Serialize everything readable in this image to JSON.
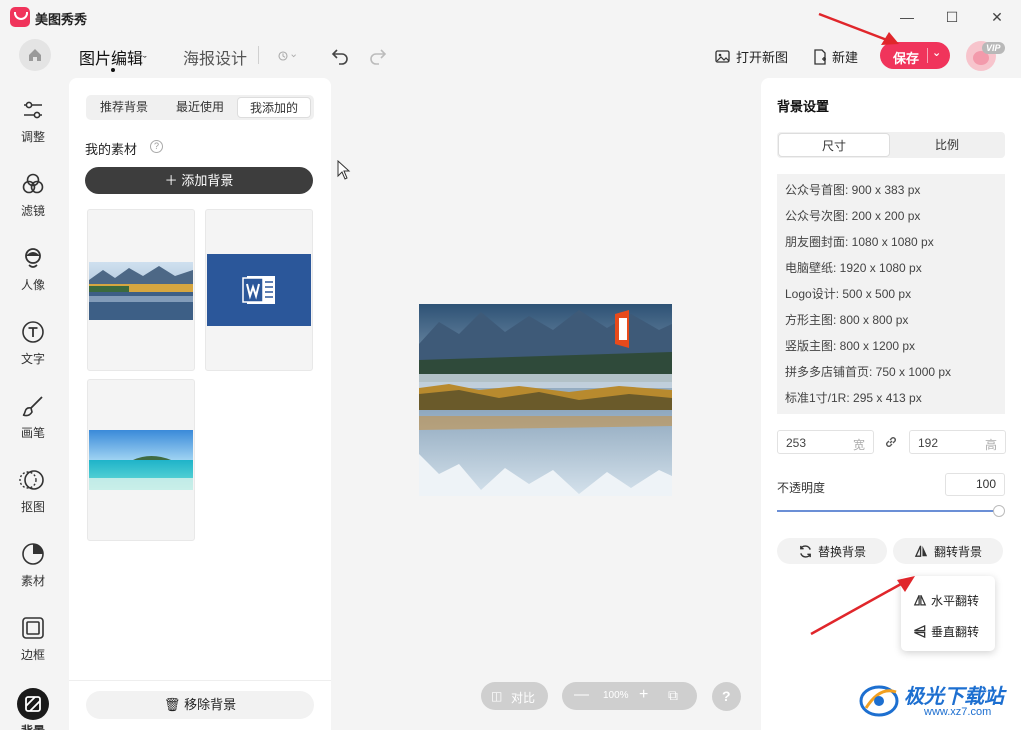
{
  "titlebar": {
    "app_name": "美图秀秀",
    "minimize": "—",
    "maximize": "☐",
    "close": "✕"
  },
  "toolbar": {
    "tab_edit": "图片编辑",
    "tab_poster": "海报设计",
    "open_new": "打开新图",
    "new": "新建",
    "save": "保存",
    "vip": "VIP"
  },
  "leftnav": {
    "items": [
      {
        "label": "调整",
        "icon": "adjust-icon"
      },
      {
        "label": "滤镜",
        "icon": "filter-icon"
      },
      {
        "label": "人像",
        "icon": "portrait-icon"
      },
      {
        "label": "文字",
        "icon": "text-icon"
      },
      {
        "label": "画笔",
        "icon": "brush-icon"
      },
      {
        "label": "抠图",
        "icon": "cutout-icon"
      },
      {
        "label": "素材",
        "icon": "sticker-icon"
      },
      {
        "label": "边框",
        "icon": "frame-icon"
      },
      {
        "label": "背景",
        "icon": "background-icon"
      }
    ]
  },
  "left_panel": {
    "tabs": [
      "推荐背景",
      "最近使用",
      "我添加的"
    ],
    "section_title": "我的素材",
    "add_bg": "添加背景",
    "remove_bg": "移除背景"
  },
  "canvas": {
    "compare": "对比",
    "zoom": "100%",
    "help": "?"
  },
  "right_panel": {
    "title": "背景设置",
    "seg_size": "尺寸",
    "seg_ratio": "比例",
    "presets": [
      "公众号首图: 900 x 383 px",
      "公众号次图: 200 x 200 px",
      "朋友圈封面: 1080 x 1080 px",
      "电脑壁纸: 1920 x 1080 px",
      "Logo设计: 500 x 500 px",
      "方形主图: 800 x 800 px",
      "竖版主图: 800 x 1200 px",
      "拼多多店铺首页: 750 x 1000 px",
      "标准1寸/1R: 295 x 413 px"
    ],
    "width_value": "253",
    "width_unit": "宽",
    "height_value": "192",
    "height_unit": "高",
    "opacity_label": "不透明度",
    "opacity_value": "100",
    "replace_bg": "替换背景",
    "flip_bg": "翻转背景",
    "flip_h": "水平翻转",
    "flip_v": "垂直翻转"
  },
  "watermark": {
    "name": "极光下载站",
    "url": "www.xz7.com"
  },
  "colors": {
    "accent": "#f0345b",
    "arrow": "#e0262b",
    "slider": "#6b8fd6"
  }
}
